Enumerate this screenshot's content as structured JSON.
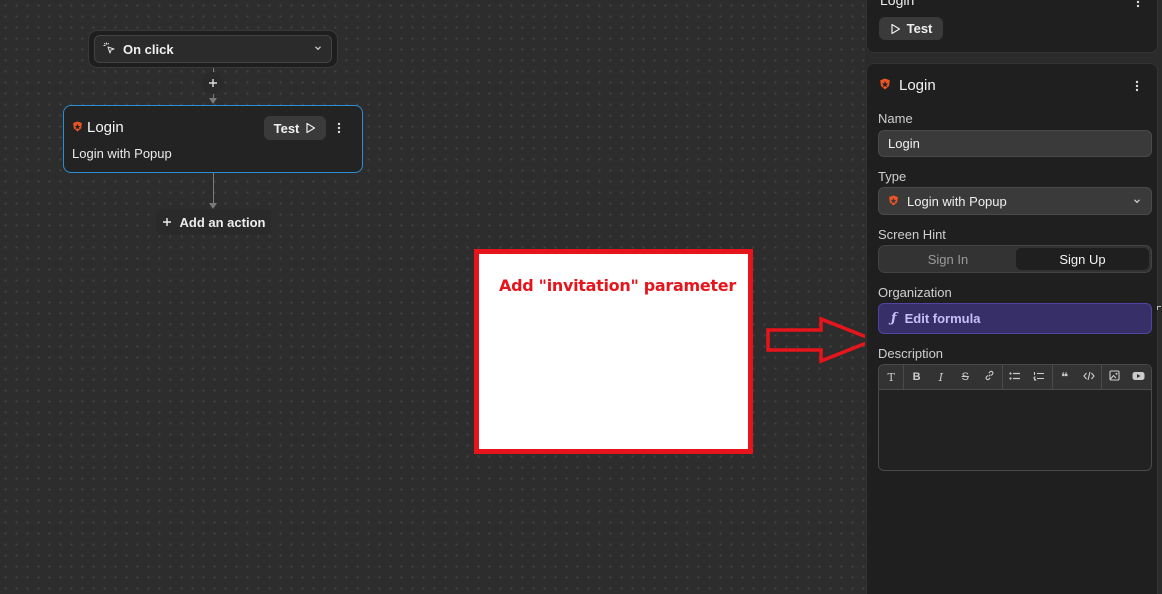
{
  "canvas": {
    "trigger": {
      "label": "On click",
      "icon": "pointer-click-icon"
    },
    "login_node": {
      "title": "Login",
      "subtitle": "Login with Popup",
      "test_label": "Test",
      "icon": "auth0-shield-icon"
    },
    "add_action_label": "Add an action"
  },
  "annotation": {
    "text": "Add \"invitation\" parameter",
    "color": "#e8141c"
  },
  "panel": {
    "top_card": {
      "title": "Login",
      "test_label": "Test"
    },
    "main_card": {
      "title": "Login",
      "name_label": "Name",
      "name_value": "Login",
      "type_label": "Type",
      "type_value": "Login with Popup",
      "screen_hint_label": "Screen Hint",
      "screen_hint_options": [
        "Sign In",
        "Sign Up"
      ],
      "screen_hint_selected": "Sign Up",
      "organization_label": "Organization",
      "organization_value": "Edit formula",
      "description_label": "Description"
    }
  },
  "colors": {
    "selection_border": "#2d8ed6",
    "auth0_red": "#eb5424",
    "formula_bg": "#372f68"
  }
}
